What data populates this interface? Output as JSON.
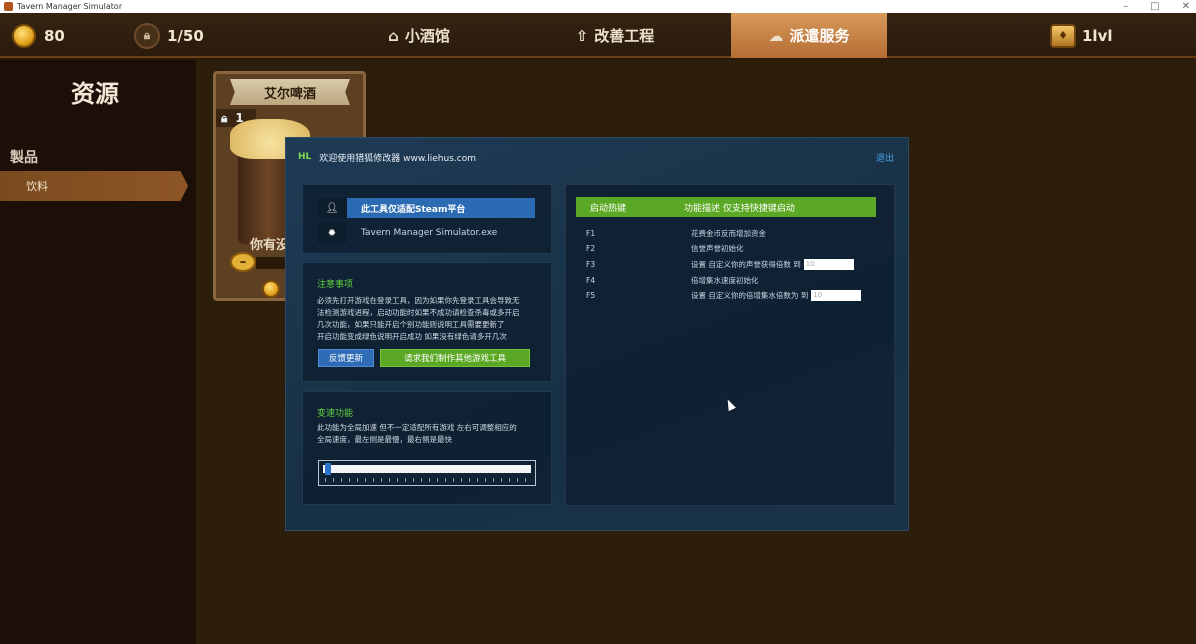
{
  "window": {
    "title": "Tavern Manager Simulator",
    "buttons": [
      "–",
      "□",
      "✕"
    ]
  },
  "topbar": {
    "coins": "80",
    "capacity": "1/50",
    "tabs": [
      {
        "label": "小酒馆",
        "icon": "house-icon"
      },
      {
        "label": "改善工程",
        "icon": "upgrade-icon"
      },
      {
        "label": "派遣服务",
        "icon": "delivery-icon",
        "active": true
      }
    ],
    "level": "1lvl"
  },
  "sidebar": {
    "title": "资源",
    "section": "製品",
    "item": "饮料"
  },
  "card": {
    "name": "艾尔啤酒",
    "lock_level": "1",
    "have_text": "你有没"
  },
  "tool": {
    "header_tag": "HL",
    "header_text": "欢迎使用猎狐修改器 www.liehus.com",
    "exit": "退出",
    "platform_label": "此工具仅适配Steam平台",
    "process_name": "Tavern Manager Simulator.exe",
    "notes_title": "注意事项",
    "notes": [
      "必须先打开游戏在登录工具，因为如果你先登录工具会导致无",
      "法检测游戏进程，启动功能时如果不成功请检查杀毒或多开启",
      "几次功能，如果只能开启个别功能则说明工具需要更新了",
      "开启功能变成绿色说明开启成功 如果没有绿色请多开几次"
    ],
    "feedback_button": "反馈更新",
    "request_button": "请求我们制作其他游戏工具",
    "speed_title": "变速功能",
    "speed_desc": [
      "此功能为全局加速 但不一定适配所有游戏 左右可调整相应的",
      "全局速度，最左侧是最慢，最右侧是最快"
    ],
    "speed_value": 0.01,
    "hotkey_header": {
      "key": "启动热键",
      "desc": "功能描述 仅支持快捷键启动"
    },
    "hotkeys": [
      {
        "key": "F1",
        "desc": "花费金币反而增加资金"
      },
      {
        "key": "F2",
        "desc": "信誉声誉初始化"
      },
      {
        "key": "F3",
        "desc": "设置 自定义你的声誉获得倍数 到",
        "input": "10"
      },
      {
        "key": "F4",
        "desc": "倍增集水速度初始化"
      },
      {
        "key": "F5",
        "desc": "设置 自定义你的倍增集水倍数为 到",
        "input": "10"
      }
    ]
  }
}
